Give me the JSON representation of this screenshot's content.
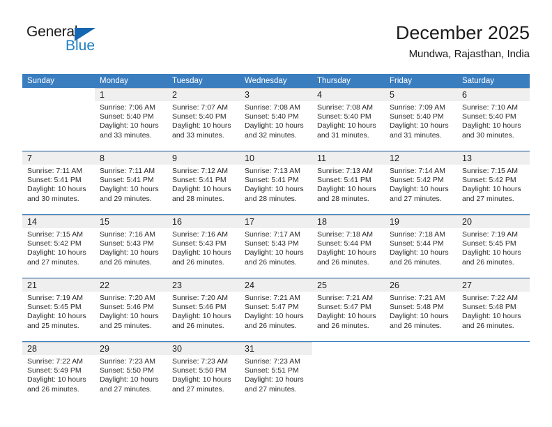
{
  "logo": {
    "word_one": "General",
    "word_two": "Blue",
    "triangle_color": "#1567b2",
    "blue_color": "#1f7fc4"
  },
  "header": {
    "title": "December 2025",
    "subtitle": "Mundwa, Rajasthan, India"
  },
  "theme": {
    "header_blue": "#3b7ec0",
    "daynum_band": "#efefef",
    "grid_line": "#c9c9c9"
  },
  "weekday_headers": [
    "Sunday",
    "Monday",
    "Tuesday",
    "Wednesday",
    "Thursday",
    "Friday",
    "Saturday"
  ],
  "weeks": [
    [
      {
        "day": "",
        "sunrise": "",
        "sunset": "",
        "daylight": "",
        "empty": true
      },
      {
        "day": "1",
        "sunrise": "Sunrise: 7:06 AM",
        "sunset": "Sunset: 5:40 PM",
        "daylight": "Daylight: 10 hours and 33 minutes."
      },
      {
        "day": "2",
        "sunrise": "Sunrise: 7:07 AM",
        "sunset": "Sunset: 5:40 PM",
        "daylight": "Daylight: 10 hours and 33 minutes."
      },
      {
        "day": "3",
        "sunrise": "Sunrise: 7:08 AM",
        "sunset": "Sunset: 5:40 PM",
        "daylight": "Daylight: 10 hours and 32 minutes."
      },
      {
        "day": "4",
        "sunrise": "Sunrise: 7:08 AM",
        "sunset": "Sunset: 5:40 PM",
        "daylight": "Daylight: 10 hours and 31 minutes."
      },
      {
        "day": "5",
        "sunrise": "Sunrise: 7:09 AM",
        "sunset": "Sunset: 5:40 PM",
        "daylight": "Daylight: 10 hours and 31 minutes."
      },
      {
        "day": "6",
        "sunrise": "Sunrise: 7:10 AM",
        "sunset": "Sunset: 5:40 PM",
        "daylight": "Daylight: 10 hours and 30 minutes."
      }
    ],
    [
      {
        "day": "7",
        "sunrise": "Sunrise: 7:11 AM",
        "sunset": "Sunset: 5:41 PM",
        "daylight": "Daylight: 10 hours and 30 minutes."
      },
      {
        "day": "8",
        "sunrise": "Sunrise: 7:11 AM",
        "sunset": "Sunset: 5:41 PM",
        "daylight": "Daylight: 10 hours and 29 minutes."
      },
      {
        "day": "9",
        "sunrise": "Sunrise: 7:12 AM",
        "sunset": "Sunset: 5:41 PM",
        "daylight": "Daylight: 10 hours and 28 minutes."
      },
      {
        "day": "10",
        "sunrise": "Sunrise: 7:13 AM",
        "sunset": "Sunset: 5:41 PM",
        "daylight": "Daylight: 10 hours and 28 minutes."
      },
      {
        "day": "11",
        "sunrise": "Sunrise: 7:13 AM",
        "sunset": "Sunset: 5:41 PM",
        "daylight": "Daylight: 10 hours and 28 minutes."
      },
      {
        "day": "12",
        "sunrise": "Sunrise: 7:14 AM",
        "sunset": "Sunset: 5:42 PM",
        "daylight": "Daylight: 10 hours and 27 minutes."
      },
      {
        "day": "13",
        "sunrise": "Sunrise: 7:15 AM",
        "sunset": "Sunset: 5:42 PM",
        "daylight": "Daylight: 10 hours and 27 minutes."
      }
    ],
    [
      {
        "day": "14",
        "sunrise": "Sunrise: 7:15 AM",
        "sunset": "Sunset: 5:42 PM",
        "daylight": "Daylight: 10 hours and 27 minutes."
      },
      {
        "day": "15",
        "sunrise": "Sunrise: 7:16 AM",
        "sunset": "Sunset: 5:43 PM",
        "daylight": "Daylight: 10 hours and 26 minutes."
      },
      {
        "day": "16",
        "sunrise": "Sunrise: 7:16 AM",
        "sunset": "Sunset: 5:43 PM",
        "daylight": "Daylight: 10 hours and 26 minutes."
      },
      {
        "day": "17",
        "sunrise": "Sunrise: 7:17 AM",
        "sunset": "Sunset: 5:43 PM",
        "daylight": "Daylight: 10 hours and 26 minutes."
      },
      {
        "day": "18",
        "sunrise": "Sunrise: 7:18 AM",
        "sunset": "Sunset: 5:44 PM",
        "daylight": "Daylight: 10 hours and 26 minutes."
      },
      {
        "day": "19",
        "sunrise": "Sunrise: 7:18 AM",
        "sunset": "Sunset: 5:44 PM",
        "daylight": "Daylight: 10 hours and 26 minutes."
      },
      {
        "day": "20",
        "sunrise": "Sunrise: 7:19 AM",
        "sunset": "Sunset: 5:45 PM",
        "daylight": "Daylight: 10 hours and 26 minutes."
      }
    ],
    [
      {
        "day": "21",
        "sunrise": "Sunrise: 7:19 AM",
        "sunset": "Sunset: 5:45 PM",
        "daylight": "Daylight: 10 hours and 25 minutes."
      },
      {
        "day": "22",
        "sunrise": "Sunrise: 7:20 AM",
        "sunset": "Sunset: 5:46 PM",
        "daylight": "Daylight: 10 hours and 25 minutes."
      },
      {
        "day": "23",
        "sunrise": "Sunrise: 7:20 AM",
        "sunset": "Sunset: 5:46 PM",
        "daylight": "Daylight: 10 hours and 26 minutes."
      },
      {
        "day": "24",
        "sunrise": "Sunrise: 7:21 AM",
        "sunset": "Sunset: 5:47 PM",
        "daylight": "Daylight: 10 hours and 26 minutes."
      },
      {
        "day": "25",
        "sunrise": "Sunrise: 7:21 AM",
        "sunset": "Sunset: 5:47 PM",
        "daylight": "Daylight: 10 hours and 26 minutes."
      },
      {
        "day": "26",
        "sunrise": "Sunrise: 7:21 AM",
        "sunset": "Sunset: 5:48 PM",
        "daylight": "Daylight: 10 hours and 26 minutes."
      },
      {
        "day": "27",
        "sunrise": "Sunrise: 7:22 AM",
        "sunset": "Sunset: 5:48 PM",
        "daylight": "Daylight: 10 hours and 26 minutes."
      }
    ],
    [
      {
        "day": "28",
        "sunrise": "Sunrise: 7:22 AM",
        "sunset": "Sunset: 5:49 PM",
        "daylight": "Daylight: 10 hours and 26 minutes."
      },
      {
        "day": "29",
        "sunrise": "Sunrise: 7:23 AM",
        "sunset": "Sunset: 5:50 PM",
        "daylight": "Daylight: 10 hours and 27 minutes."
      },
      {
        "day": "30",
        "sunrise": "Sunrise: 7:23 AM",
        "sunset": "Sunset: 5:50 PM",
        "daylight": "Daylight: 10 hours and 27 minutes."
      },
      {
        "day": "31",
        "sunrise": "Sunrise: 7:23 AM",
        "sunset": "Sunset: 5:51 PM",
        "daylight": "Daylight: 10 hours and 27 minutes."
      },
      {
        "day": "",
        "sunrise": "",
        "sunset": "",
        "daylight": "",
        "empty": true
      },
      {
        "day": "",
        "sunrise": "",
        "sunset": "",
        "daylight": "",
        "empty": true
      },
      {
        "day": "",
        "sunrise": "",
        "sunset": "",
        "daylight": "",
        "empty": true
      }
    ]
  ]
}
